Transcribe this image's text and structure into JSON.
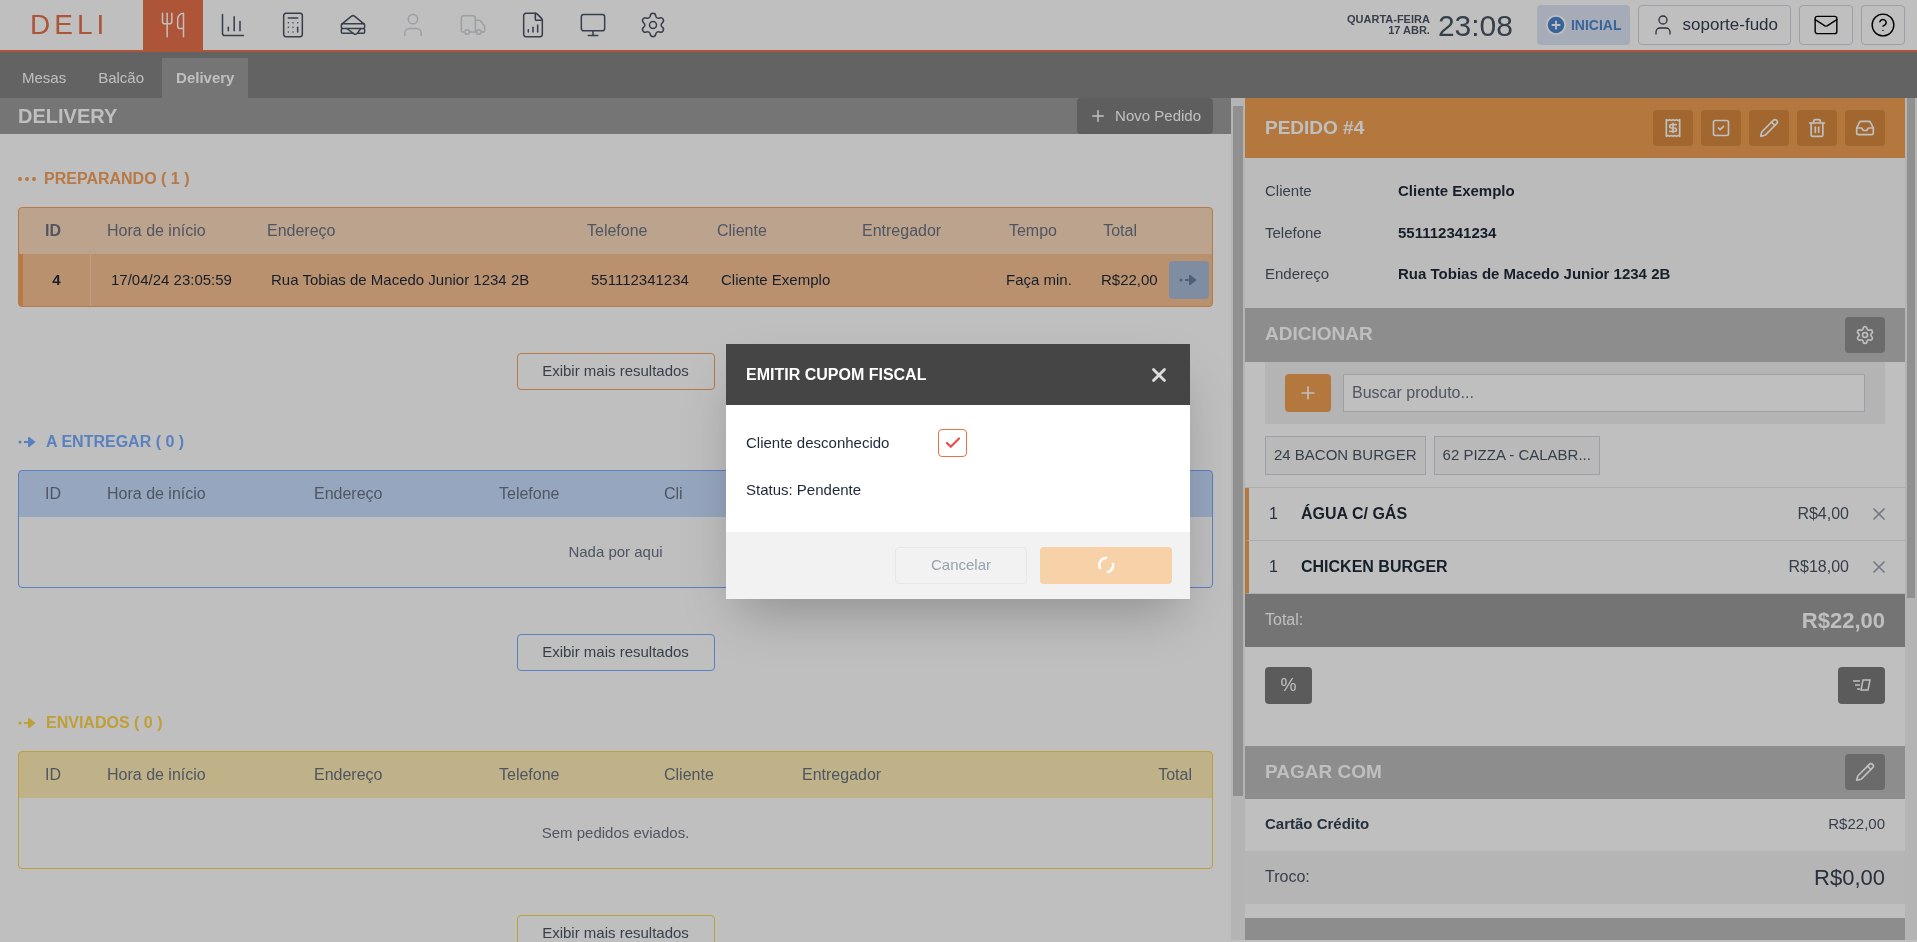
{
  "top_bar": {
    "logo": "DELI",
    "nav": [
      {
        "selected": true,
        "disabled": false
      },
      {
        "selected": false,
        "disabled": false
      },
      {
        "selected": false,
        "disabled": false
      },
      {
        "selected": false,
        "disabled": false
      },
      {
        "selected": false,
        "disabled": true
      },
      {
        "selected": false,
        "disabled": true
      },
      {
        "selected": false,
        "disabled": false
      },
      {
        "selected": false,
        "disabled": false
      },
      {
        "selected": false,
        "disabled": false
      }
    ],
    "weekday": "QUARTA-FEIRA",
    "date": "17 ABR.",
    "time": "23:08",
    "home_button": "INICIAL",
    "user_button": "soporte-fudo"
  },
  "tabs": [
    {
      "label": "Mesas",
      "selected": false
    },
    {
      "label": "Balcão",
      "selected": false
    },
    {
      "label": "Delivery",
      "selected": true
    }
  ],
  "delivery": {
    "title": "DELIVERY",
    "new_order_button": "Novo Pedido",
    "sections": [
      {
        "kind": "preparing",
        "title": "PREPARANDO ( 1 )",
        "columns": [
          "ID",
          "Hora de início",
          "Endereço",
          "Telefone",
          "Cliente",
          "Entregador",
          "Tempo",
          "Total"
        ],
        "rows": [
          {
            "cells": [
              "4",
              "17/04/24 23:05:59",
              "Rua Tobias de Macedo Junior 1234 2B",
              "551112341234",
              "Cliente Exemplo",
              "",
              "Faça min.",
              "R$22,00"
            ]
          }
        ],
        "more_button": "Exibir mais resultados"
      },
      {
        "kind": "to_deliver",
        "title": "A ENTREGAR ( 0 )",
        "columns": [
          "ID",
          "Hora de início",
          "Endereço",
          "Telefone",
          "Cli"
        ],
        "empty": "Nada por aqui",
        "more_button": "Exibir mais resultados"
      },
      {
        "kind": "sent",
        "title": "ENVIADOS ( 0 )",
        "columns": [
          "ID",
          "Hora de início",
          "Endereço",
          "Telefone",
          "Cliente",
          "Entregador",
          "Total"
        ],
        "empty": "Sem pedidos eviados.",
        "more_button": "Exibir mais resultados"
      }
    ]
  },
  "order": {
    "title": "PEDIDO #4",
    "info": [
      {
        "label": "Cliente",
        "value": "Cliente Exemplo"
      },
      {
        "label": "Telefone",
        "value": "551112341234"
      },
      {
        "label": "Endereço",
        "value": "Rua Tobias de Macedo Junior 1234 2B"
      }
    ],
    "add_title": "ADICIONAR",
    "search": {
      "placeholder": "Buscar produto..."
    },
    "quick_products": [
      {
        "code": "24",
        "name": "BACON BURGER"
      },
      {
        "code": "62",
        "name": "PIZZA - CALABR..."
      }
    ],
    "items": [
      {
        "qty": "1",
        "name": "ÁGUA C/ GÁS",
        "price": "R$4,00"
      },
      {
        "qty": "1",
        "name": "CHICKEN BURGER",
        "price": "R$18,00"
      }
    ],
    "total_label": "Total:",
    "total": "R$22,00",
    "discount_button": "%",
    "pay_title": "PAGAR COM",
    "payments": [
      {
        "method": "Cartão Crédito",
        "amount": "R$22,00"
      }
    ],
    "change_label": "Troco:",
    "change": "R$0,00"
  },
  "modal": {
    "title": "EMITIR CUPOM FISCAL",
    "unknown_client": {
      "label": "Cliente desconhecido",
      "checked": true
    },
    "status": "Status: Pendente",
    "cancel_button": {
      "label": "Cancelar",
      "disabled": true
    },
    "confirm_button": {
      "loading": true
    }
  }
}
